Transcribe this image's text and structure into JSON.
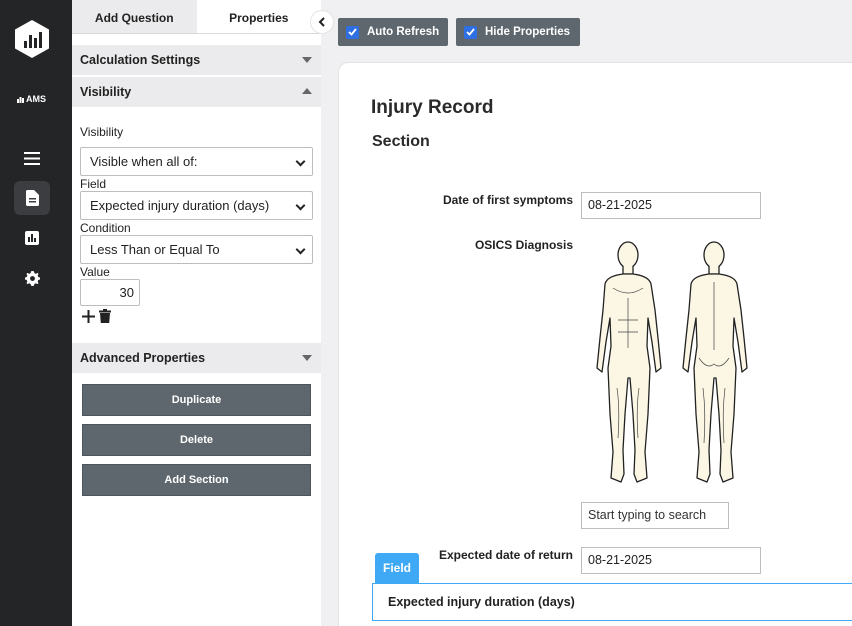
{
  "rail": {
    "brand": "AMS",
    "icons": [
      "logo-icon",
      "menu-icon",
      "document-icon",
      "chart-icon",
      "settings-icon"
    ]
  },
  "panel": {
    "tabs": [
      {
        "label": "Add Question"
      },
      {
        "label": "Properties"
      }
    ],
    "sections": {
      "calculation": "Calculation Settings",
      "visibility": "Visibility",
      "advanced": "Advanced Properties"
    },
    "visibility": {
      "visibility_label": "Visibility",
      "visibility_value": "Visible when all of:",
      "field_label": "Field",
      "field_value": "Expected injury duration (days)",
      "condition_label": "Condition",
      "condition_value": "Less Than or Equal To",
      "value_label": "Value",
      "value": "30"
    },
    "buttons": {
      "duplicate": "Duplicate",
      "delete": "Delete",
      "add_section": "Add Section"
    }
  },
  "toolbar": {
    "auto_refresh": "Auto Refresh",
    "hide_properties": "Hide Properties"
  },
  "form": {
    "title": "Injury Record",
    "section": "Section",
    "q_symptoms_label": "Date of first symptoms",
    "q_symptoms_value": "08-21-2025",
    "q_diagnosis_label": "OSICS Diagnosis",
    "search_placeholder": "Start typing to search",
    "q_return_label": "Expected date of return",
    "q_return_value": "08-21-2025",
    "field_tag": "Field",
    "field_title": "Expected injury duration (days)"
  },
  "colors": {
    "rail": "#242527",
    "button": "#5e676e",
    "accent": "#3fa9f5",
    "checkbox": "#2f6fe4"
  }
}
